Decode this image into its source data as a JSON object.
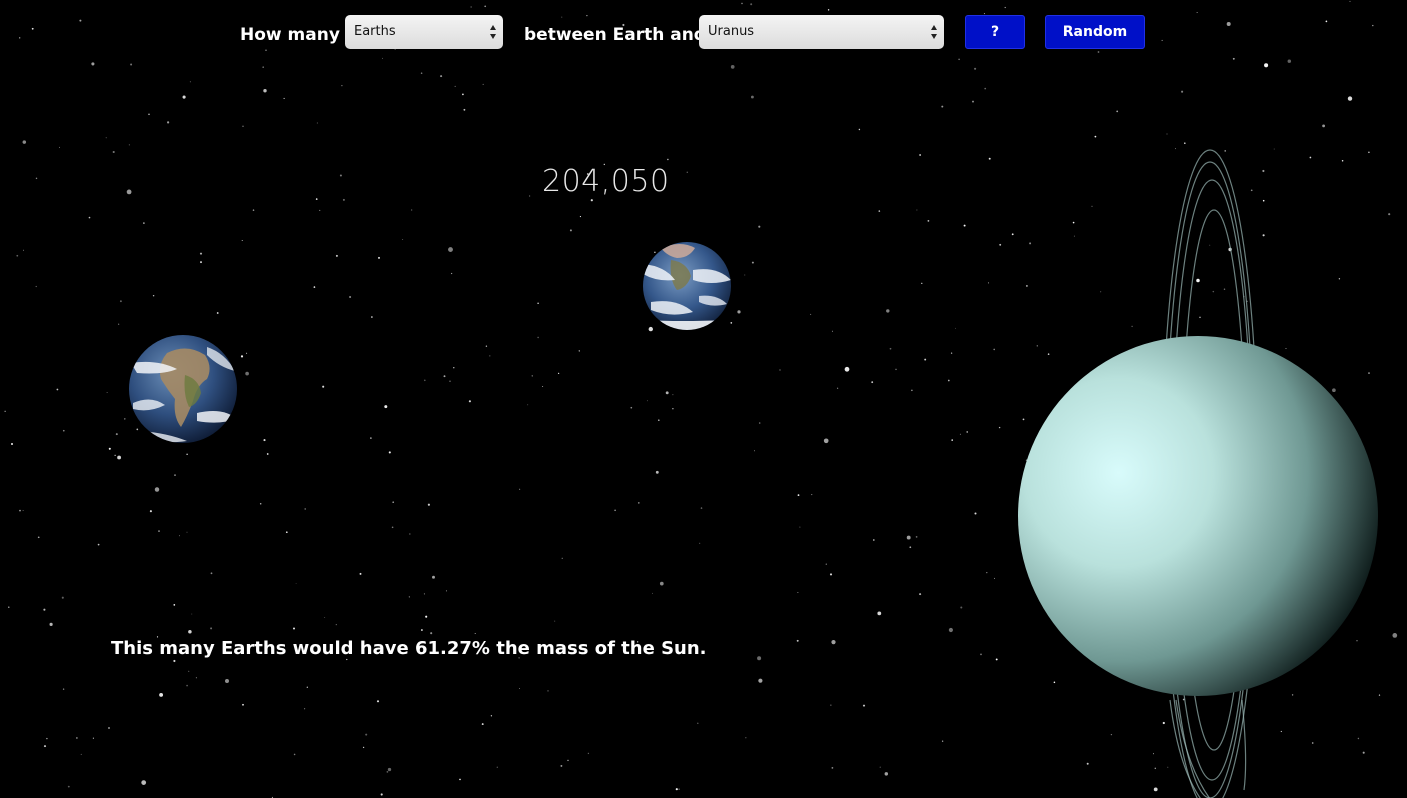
{
  "controls": {
    "prefix_label": "How many",
    "object_select": {
      "value": "Earths"
    },
    "middle_label": "between Earth and",
    "target_select": {
      "value": "Uranus"
    },
    "help_button_label": "?",
    "random_button_label": "Random"
  },
  "result": {
    "count": "204,050",
    "fact": "This many Earths would have 61.27% the mass of the Sun."
  },
  "colors": {
    "background": "#000000",
    "button_blue": "#0010c8",
    "uranus": "#bfe6e2",
    "text": "#ffffff"
  },
  "icons": {
    "select_arrows": "updown-arrows-icon",
    "earth": "earth-planet",
    "uranus": "uranus-planet"
  }
}
